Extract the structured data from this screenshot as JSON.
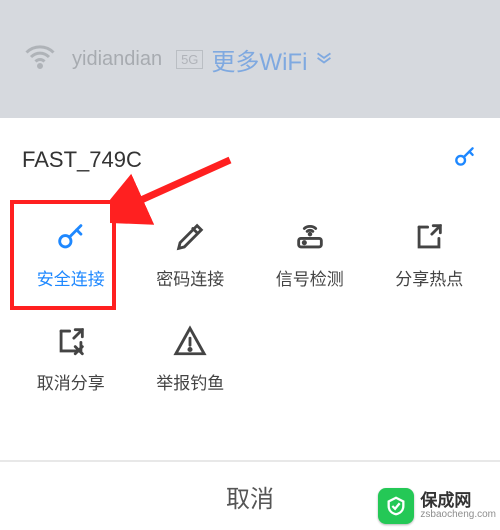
{
  "top": {
    "wifi_name": "yidiandian",
    "band": "5G",
    "more_label": "更多WiFi"
  },
  "sheet": {
    "title": "FAST_749C"
  },
  "tiles": [
    {
      "label": "安全连接",
      "name": "secure-connect",
      "active": true
    },
    {
      "label": "密码连接",
      "name": "password-connect",
      "active": false
    },
    {
      "label": "信号检测",
      "name": "signal-test",
      "active": false
    },
    {
      "label": "分享热点",
      "name": "share-hotspot",
      "active": false
    },
    {
      "label": "取消分享",
      "name": "cancel-share",
      "active": false
    },
    {
      "label": "举报钓鱼",
      "name": "report-phishing",
      "active": false
    }
  ],
  "cancel": "取消",
  "watermark": {
    "main": "保成网",
    "sub": "zsbaocheng.com"
  },
  "colors": {
    "accent": "#1e88ff",
    "highlight": "#ff2020"
  }
}
